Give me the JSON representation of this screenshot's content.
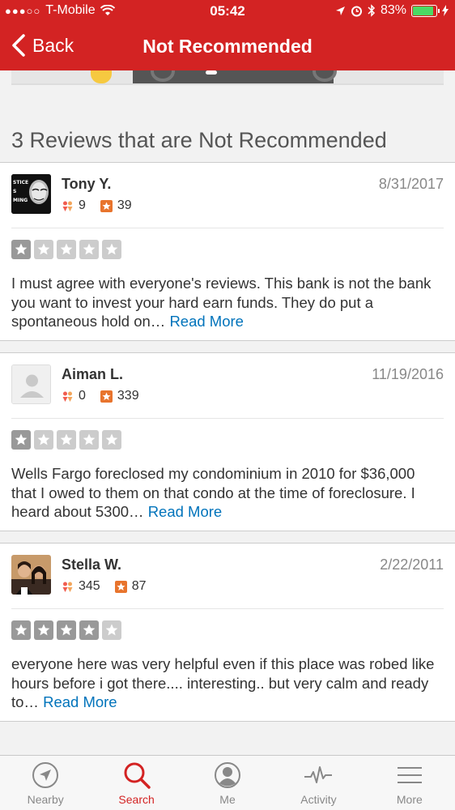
{
  "status": {
    "carrier": "T-Mobile",
    "time": "05:42",
    "battery": "83%",
    "battery_level": 0.83
  },
  "nav": {
    "back_label": "Back",
    "title": "Not Recommended"
  },
  "section_title": "3 Reviews that are Not Recommended",
  "reviews": [
    {
      "name": "Tony Y.",
      "date": "8/31/2017",
      "friends": "9",
      "review_count": "39",
      "rating": 1,
      "avatar_text": "STICE\nS\nMING",
      "text": "I must agree with everyone's reviews. This bank is not the bank you want to invest your hard earn funds. They do put a spontaneous hold on…",
      "read_more": "Read More"
    },
    {
      "name": "Aiman L.",
      "date": "11/19/2016",
      "friends": "0",
      "review_count": "339",
      "rating": 1,
      "text": "Wells Fargo foreclosed my condominium in 2010 for $36,000 that I owed to them on that condo at the time of foreclosure. I heard about 5300…",
      "read_more": "Read More"
    },
    {
      "name": "Stella W.",
      "date": "2/22/2011",
      "friends": "345",
      "review_count": "87",
      "rating": 4,
      "text": "everyone here was very helpful even if this place was robed like hours before i got there.... interesting..  but very calm and ready to…",
      "read_more": "Read More"
    }
  ],
  "tabs": [
    {
      "label": "Nearby",
      "icon": "compass-icon"
    },
    {
      "label": "Search",
      "icon": "search-icon",
      "active": true
    },
    {
      "label": "Me",
      "icon": "profile-icon"
    },
    {
      "label": "Activity",
      "icon": "activity-icon"
    },
    {
      "label": "More",
      "icon": "menu-icon"
    }
  ],
  "colors": {
    "brand_red": "#d32323",
    "link_blue": "#0073bb",
    "star_on": "#999999",
    "star_off": "#cccccc"
  }
}
